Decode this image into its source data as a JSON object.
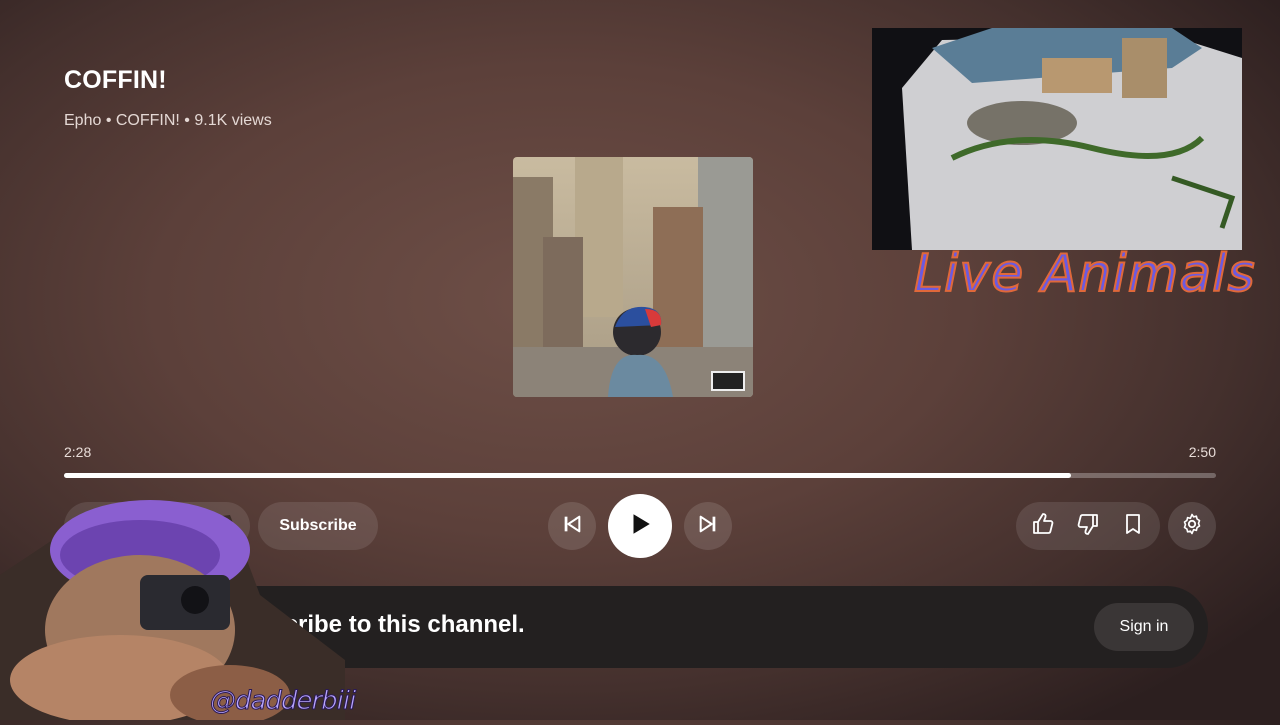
{
  "video": {
    "title": "COFFIN!",
    "subtitle": "Epho • COFFIN! • 9.1K views"
  },
  "player": {
    "current_time": "2:28",
    "duration": "2:50",
    "progress_fraction": 0.874
  },
  "controls": {
    "subscribe_label": "Subscribe",
    "previous_icon": "skip-previous-icon",
    "play_icon": "play-icon",
    "next_icon": "skip-next-icon",
    "like_icon": "thumbs-up-icon",
    "dislike_icon": "thumbs-down-icon",
    "save_icon": "bookmark-icon",
    "settings_icon": "gear-icon"
  },
  "banner": {
    "text": "ubscribe to this channel.",
    "sign_in_label": "Sign in"
  },
  "overlays": {
    "camera_title": "Live Animals",
    "streamer_handle": "@dadderbiii"
  },
  "colors": {
    "accent": "#ffffff",
    "background": "#5c403a",
    "banner": "#232020"
  }
}
